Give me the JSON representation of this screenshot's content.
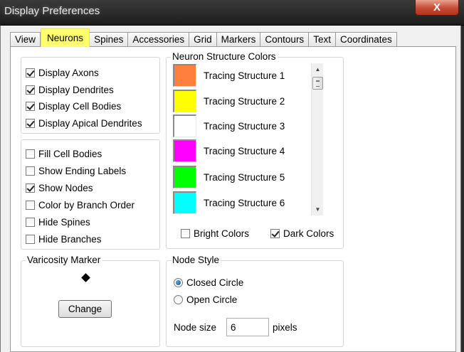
{
  "window": {
    "title": "Display Preferences",
    "close_glyph": "X"
  },
  "tabs": [
    "View",
    "Neurons",
    "Spines",
    "Accessories",
    "Grid",
    "Markers",
    "Contours",
    "Text",
    "Coordinates"
  ],
  "active_tab": "Neurons",
  "display_group": {
    "items": [
      {
        "label": "Display Axons",
        "checked": true
      },
      {
        "label": "Display Dendrites",
        "checked": true
      },
      {
        "label": "Display Cell Bodies",
        "checked": true
      },
      {
        "label": "Display Apical Dendrites",
        "checked": true
      }
    ]
  },
  "options_group": {
    "items": [
      {
        "label": "Fill Cell Bodies",
        "checked": false
      },
      {
        "label": "Show Ending Labels",
        "checked": false
      },
      {
        "label": "Show Nodes",
        "checked": true
      },
      {
        "label": "Color by Branch Order",
        "checked": false
      },
      {
        "label": "Hide Spines",
        "checked": false
      },
      {
        "label": "Hide Branches",
        "checked": false
      }
    ]
  },
  "structure_colors": {
    "title": "Neuron Structure Colors",
    "items": [
      {
        "label": "Tracing Structure 1",
        "color": "#ff7f3f"
      },
      {
        "label": "Tracing Structure 2",
        "color": "#ffff00"
      },
      {
        "label": "Tracing Structure 3",
        "color": "#ffffff"
      },
      {
        "label": "Tracing Structure 4",
        "color": "#ff00ff"
      },
      {
        "label": "Tracing Structure 5",
        "color": "#00ff00"
      },
      {
        "label": "Tracing Structure 6",
        "color": "#00ffff"
      }
    ],
    "bright_colors": {
      "label": "Bright Colors",
      "checked": false
    },
    "dark_colors": {
      "label": "Dark Colors",
      "checked": true
    },
    "scroll_up_icon": "triangle-up",
    "scroll_down_icon": "triangle-down"
  },
  "varicosity": {
    "title": "Varicosity Marker",
    "marker_icon": "diamond",
    "change_label": "Change"
  },
  "node_style": {
    "title": "Node Style",
    "options": [
      {
        "label": "Closed Circle",
        "selected": true
      },
      {
        "label": "Open Circle",
        "selected": false
      }
    ],
    "size_label": "Node size",
    "size_value": "6",
    "size_unit": "pixels"
  },
  "colors": {
    "active_tab_highlight": "#ffff6e",
    "close_button": "#c54a33",
    "radio_dot": "#0b4a8c"
  }
}
